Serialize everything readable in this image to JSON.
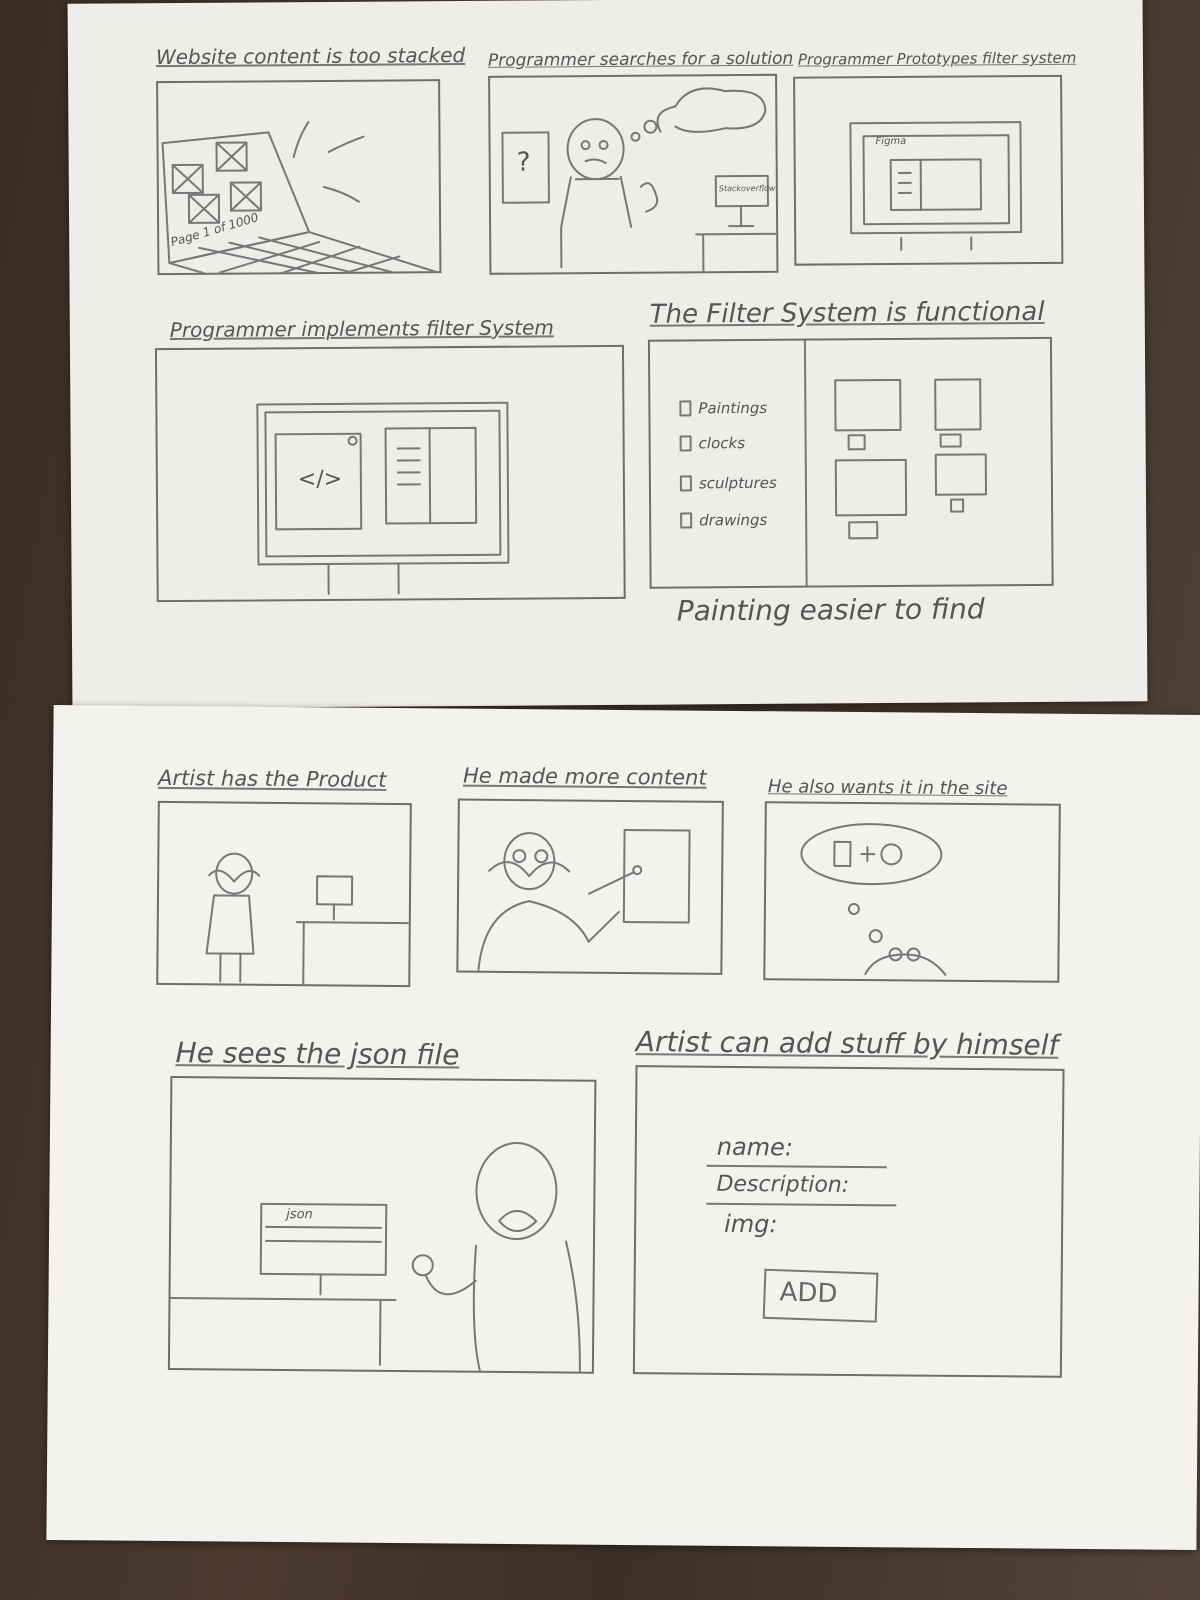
{
  "sheet_top": {
    "panels": [
      {
        "caption": "Website content is too stacked",
        "page_label": "Page 1 of 1000"
      },
      {
        "caption": "Programmer searches for a solution",
        "question_mark": "?",
        "monitor_text": "Stackoverflow"
      },
      {
        "caption": "Programmer Prototypes filter system",
        "screen_label": "Figma"
      },
      {
        "caption": "Programmer implements filter System",
        "code_symbol": "</>"
      },
      {
        "caption": "The Filter System is functional",
        "filters": [
          "Paintings",
          "clocks",
          "sculptures",
          "drawings"
        ]
      }
    ],
    "footer_note": "Painting easier to find"
  },
  "sheet_bottom": {
    "panels": [
      {
        "caption": "Artist has the Product"
      },
      {
        "caption": "He made more content"
      },
      {
        "caption": "He also wants it in the site"
      },
      {
        "caption": "He sees the json file",
        "monitor_text": "json"
      },
      {
        "caption": "Artist can add stuff by himself",
        "form_fields": [
          "name:",
          "Description:",
          "img:"
        ],
        "add_button": "ADD"
      }
    ]
  }
}
